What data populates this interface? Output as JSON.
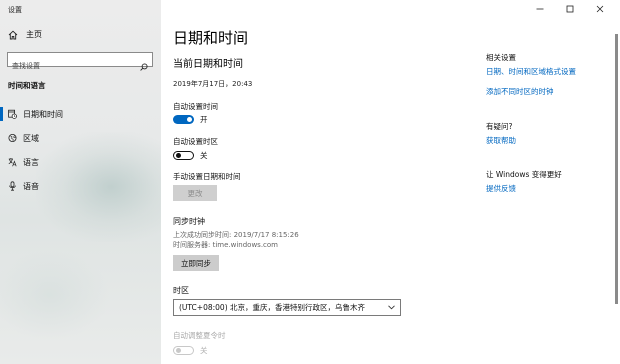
{
  "app": {
    "title": "设置"
  },
  "sidebar": {
    "home_label": "主页",
    "search": {
      "placeholder": "查找设置",
      "value": ""
    },
    "section_label": "时间和语言",
    "items": [
      {
        "label": "日期和时间",
        "icon": "calendar-clock-icon",
        "active": true
      },
      {
        "label": "区域",
        "icon": "globe-region-icon",
        "active": false
      },
      {
        "label": "语言",
        "icon": "language-icon",
        "active": false
      },
      {
        "label": "语音",
        "icon": "microphone-icon",
        "active": false
      }
    ]
  },
  "window_controls": {
    "minimize": "minimize-icon",
    "maximize": "maximize-icon",
    "close": "close-icon"
  },
  "main": {
    "title": "日期和时间",
    "current": {
      "heading": "当前日期和时间",
      "datetime": "2019年7月17日，20:43"
    },
    "auto_time": {
      "label": "自动设置时间",
      "state": "开",
      "on": true
    },
    "auto_timezone": {
      "label": "自动设置时区",
      "state": "关",
      "on": false
    },
    "manual": {
      "label": "手动设置日期和时间",
      "button": "更改",
      "enabled": false
    },
    "sync": {
      "heading": "同步时钟",
      "last_sync": "上次成功同步时间: 2019/7/17 8:15:26",
      "server": "时间服务器: time.windows.com",
      "button": "立即同步"
    },
    "timezone": {
      "label": "时区",
      "selected": "(UTC+08:00) 北京，重庆，香港特别行政区，乌鲁木齐"
    },
    "dst": {
      "label": "自动调整夏令时",
      "state": "关",
      "enabled": false
    }
  },
  "related": {
    "heading": "相关设置",
    "links": [
      "日期、时间和区域格式设置",
      "添加不同时区的时钟"
    ],
    "help": {
      "heading": "有疑问?",
      "link": "获取帮助"
    },
    "improve": {
      "heading": "让 Windows 变得更好",
      "link": "提供反馈"
    }
  },
  "colors": {
    "accent": "#0067c0",
    "sidebar_bg": "#e6e6e6",
    "button_bg": "#cccccc"
  }
}
